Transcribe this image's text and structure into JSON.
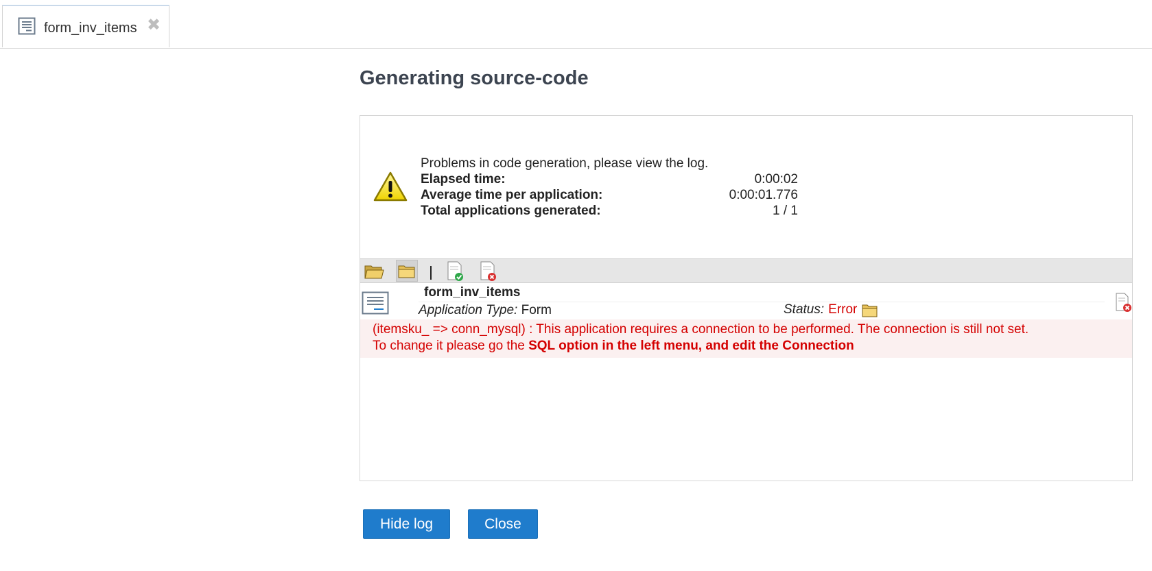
{
  "tab": {
    "label": "form_inv_items",
    "close_glyph": "✖"
  },
  "page": {
    "title": "Generating source-code"
  },
  "summary": {
    "message": "Problems in code generation, please view the log.",
    "rows": [
      {
        "label": "Elapsed time:",
        "value": "0:00:02"
      },
      {
        "label": "Average time per application:",
        "value": "0:00:01.776"
      },
      {
        "label": "Total applications generated:",
        "value": "1 / 1"
      }
    ]
  },
  "toolbar": {
    "icons": [
      "folder-open-icon",
      "folder-icon",
      "file-check-icon",
      "file-error-icon"
    ],
    "separator": "|"
  },
  "application": {
    "name": "form_inv_items",
    "type_label": "Application Type:",
    "type_value": "Form",
    "status_label": "Status:",
    "status_value": "Error"
  },
  "error": {
    "line1": "(itemsku_ => conn_mysql) : This application requires a connection to be performed. The connection is still not set.",
    "line2_prefix": "To change it please go the ",
    "line2_bold": "SQL option in the left menu, and edit the Connection"
  },
  "buttons": {
    "hide_log": "Hide log",
    "close": "Close"
  },
  "colors": {
    "primary_button": "#1f7ccc",
    "error_text": "#d40000",
    "error_bg": "#fbf0f0",
    "title": "#3c4450"
  }
}
